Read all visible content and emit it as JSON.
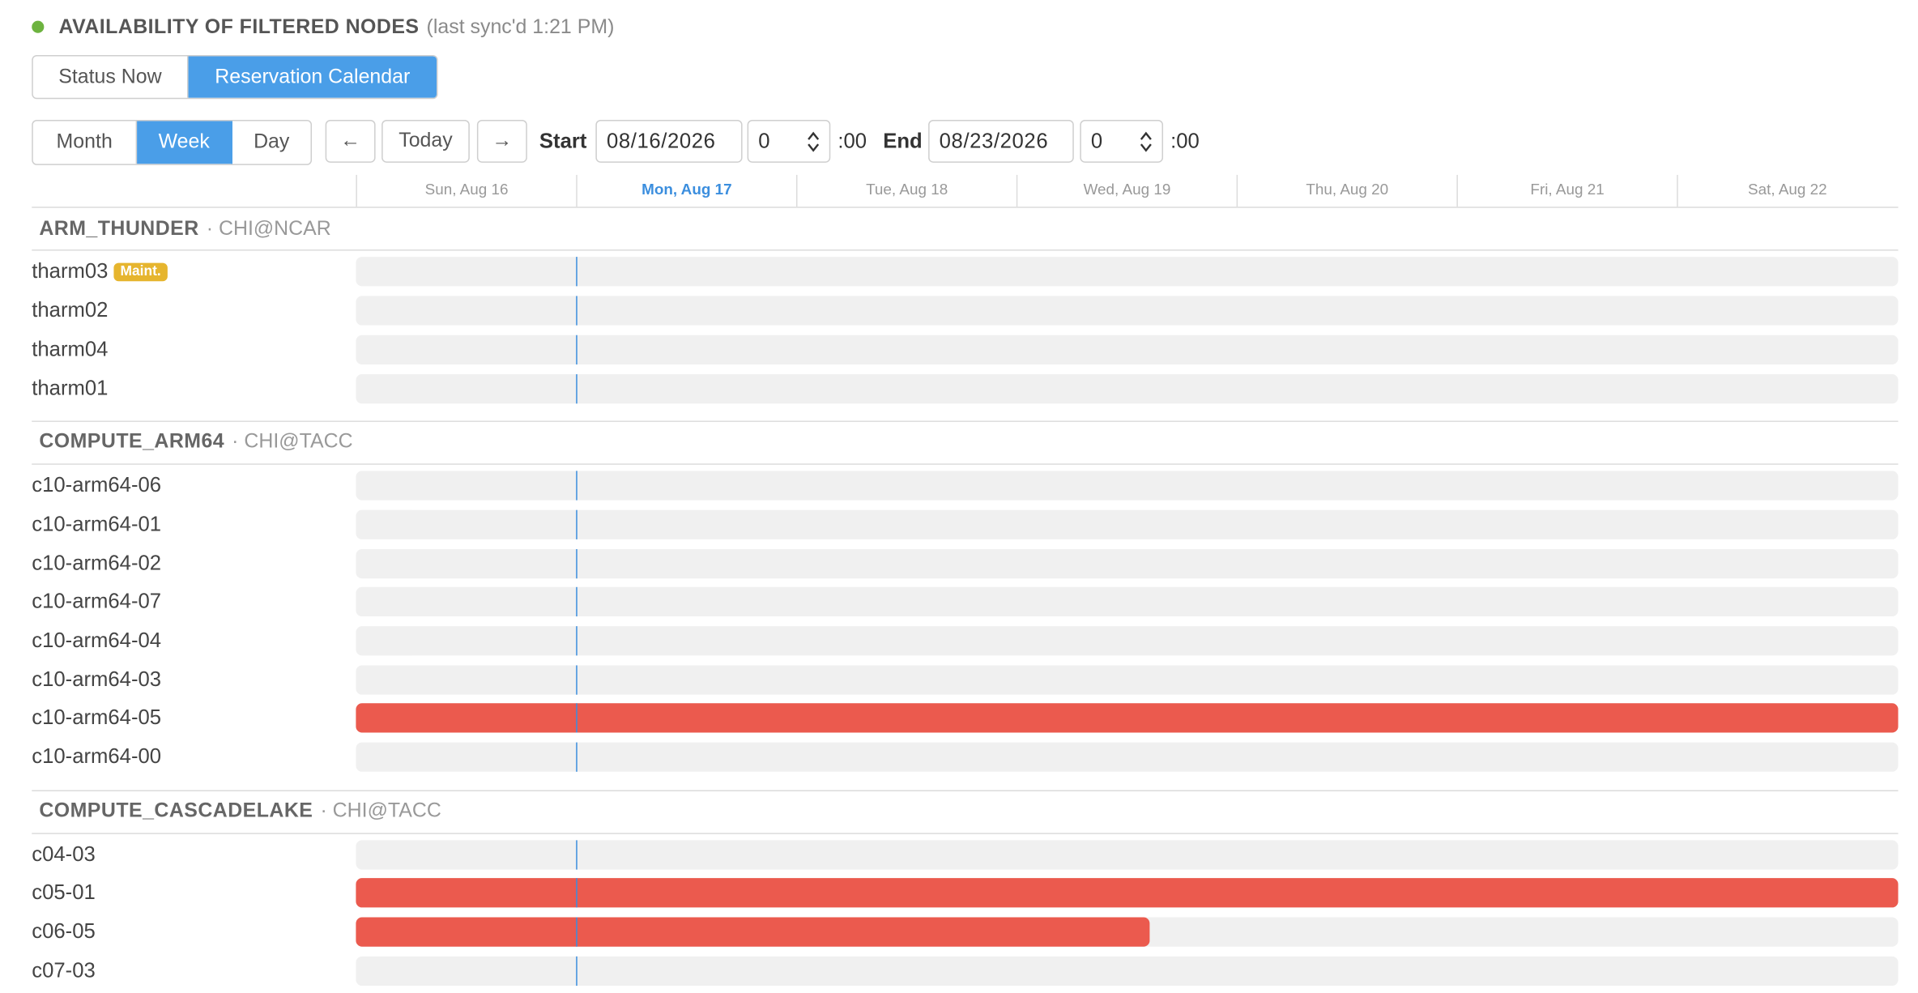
{
  "header": {
    "title": "AVAILABILITY OF FILTERED NODES",
    "sync": "(last sync'd 1:21 PM)",
    "status_color": "#6db33f"
  },
  "view_tabs": [
    "Status Now",
    "Reservation Calendar"
  ],
  "view_active": "Reservation Calendar",
  "range_tabs": [
    "Month",
    "Week",
    "Day"
  ],
  "range_active": "Week",
  "nav": {
    "prev_icon": "←",
    "today": "Today",
    "next_icon": "→"
  },
  "start": {
    "label": "Start",
    "date": "08/16/2026",
    "hour": "0",
    "suffix": ":00"
  },
  "end": {
    "label": "End",
    "date": "08/23/2026",
    "hour": "0",
    "suffix": ":00"
  },
  "days": [
    "Sun, Aug 16",
    "Mon, Aug 17",
    "Tue, Aug 18",
    "Wed, Aug 19",
    "Thu, Aug 20",
    "Fri, Aug 21",
    "Sat, Aug 22"
  ],
  "today_index": 1,
  "accent_color": "#4a9ee8",
  "reserved_color": "#eb5a4e",
  "groups": [
    {
      "name": "ARM_THUNDER",
      "site": "· CHI@NCAR",
      "nodes": [
        {
          "name": "tharm03",
          "badge": "Maint."
        },
        {
          "name": "tharm02"
        },
        {
          "name": "tharm04"
        },
        {
          "name": "tharm01"
        }
      ]
    },
    {
      "name": "COMPUTE_ARM64",
      "site": "· CHI@TACC",
      "nodes": [
        {
          "name": "c10-arm64-06"
        },
        {
          "name": "c10-arm64-01"
        },
        {
          "name": "c10-arm64-02"
        },
        {
          "name": "c10-arm64-07"
        },
        {
          "name": "c10-arm64-04"
        },
        {
          "name": "c10-arm64-03"
        },
        {
          "name": "c10-arm64-05",
          "reserved_until_day": 7
        },
        {
          "name": "c10-arm64-00"
        }
      ]
    },
    {
      "name": "COMPUTE_CASCADELAKE",
      "site": "· CHI@TACC",
      "nodes": [
        {
          "name": "c04-03"
        },
        {
          "name": "c05-01",
          "reserved_until_day": 7
        },
        {
          "name": "c06-05",
          "reserved_until_day": 3.6
        },
        {
          "name": "c07-03"
        }
      ]
    }
  ]
}
